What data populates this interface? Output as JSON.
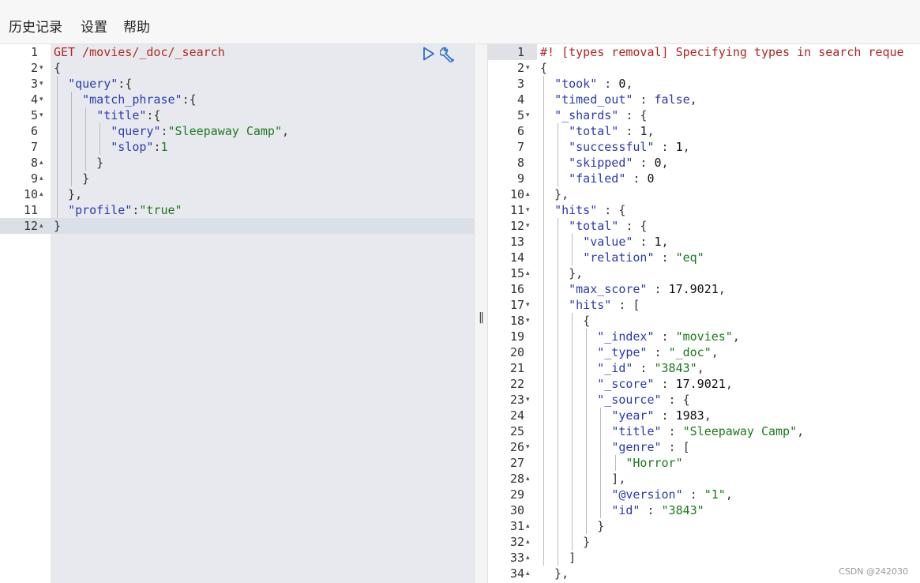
{
  "menu": {
    "history": "历史记录",
    "settings": "设置",
    "help": "帮助"
  },
  "request_editor": {
    "active_line": 12,
    "line_numbers": [
      "1",
      "2",
      "3",
      "4",
      "5",
      "6",
      "7",
      "8",
      "9",
      "10",
      "11",
      "12"
    ],
    "fold_markers": [
      "",
      "▾",
      "▾",
      "▾",
      "▾",
      "",
      "",
      "▴",
      "▴",
      "▴",
      "",
      "▴"
    ],
    "lines": [
      [
        [
          "m",
          "GET /movies/_doc/_search"
        ]
      ],
      [
        [
          "p",
          "{"
        ]
      ],
      [
        [
          "p",
          "  "
        ],
        [
          "k",
          "\"query\""
        ],
        [
          "p",
          ":{"
        ]
      ],
      [
        [
          "p",
          "    "
        ],
        [
          "k",
          "\"match_phrase\""
        ],
        [
          "p",
          ":{"
        ]
      ],
      [
        [
          "p",
          "      "
        ],
        [
          "k",
          "\"title\""
        ],
        [
          "p",
          ":{"
        ]
      ],
      [
        [
          "p",
          "        "
        ],
        [
          "k",
          "\"query\""
        ],
        [
          "p",
          ":"
        ],
        [
          "s",
          "\"Sleepaway Camp\""
        ],
        [
          "p",
          ","
        ]
      ],
      [
        [
          "p",
          "        "
        ],
        [
          "k",
          "\"slop\""
        ],
        [
          "p",
          ":"
        ],
        [
          "s",
          "1"
        ]
      ],
      [
        [
          "p",
          "      }"
        ]
      ],
      [
        [
          "p",
          "    }"
        ]
      ],
      [
        [
          "p",
          "  },"
        ]
      ],
      [
        [
          "p",
          "  "
        ],
        [
          "k",
          "\"profile\""
        ],
        [
          "p",
          ":"
        ],
        [
          "s",
          "\"true\""
        ]
      ],
      [
        [
          "p",
          "}"
        ]
      ]
    ]
  },
  "response_viewer": {
    "line_numbers": [
      "1",
      "2",
      "3",
      "4",
      "5",
      "6",
      "7",
      "8",
      "9",
      "10",
      "11",
      "12",
      "13",
      "14",
      "15",
      "16",
      "17",
      "18",
      "19",
      "20",
      "21",
      "22",
      "23",
      "24",
      "25",
      "26",
      "27",
      "28",
      "29",
      "30",
      "31",
      "32",
      "33",
      "34"
    ],
    "fold_markers": [
      "",
      "▾",
      "",
      "",
      "▾",
      "",
      "",
      "",
      "",
      "▴",
      "▾",
      "▾",
      "",
      "",
      "▴",
      "",
      "▾",
      "▾",
      "",
      "",
      "",
      "",
      "▾",
      "",
      "",
      "▾",
      "",
      "▴",
      "",
      "",
      "▴",
      "▴",
      "▴",
      "▴"
    ],
    "lines": [
      [
        [
          "c",
          "#! [types removal] Specifying types in search reque"
        ]
      ],
      [
        [
          "p",
          "{"
        ]
      ],
      [
        [
          "p",
          "  "
        ],
        [
          "k",
          "\"took\""
        ],
        [
          "p",
          " : "
        ],
        [
          "n",
          "0"
        ],
        [
          "p",
          ","
        ]
      ],
      [
        [
          "p",
          "  "
        ],
        [
          "k",
          "\"timed_out\""
        ],
        [
          "p",
          " : "
        ],
        [
          "kw",
          "false"
        ],
        [
          "p",
          ","
        ]
      ],
      [
        [
          "p",
          "  "
        ],
        [
          "k",
          "\"_shards\""
        ],
        [
          "p",
          " : {"
        ]
      ],
      [
        [
          "p",
          "    "
        ],
        [
          "k",
          "\"total\""
        ],
        [
          "p",
          " : "
        ],
        [
          "n",
          "1"
        ],
        [
          "p",
          ","
        ]
      ],
      [
        [
          "p",
          "    "
        ],
        [
          "k",
          "\"successful\""
        ],
        [
          "p",
          " : "
        ],
        [
          "n",
          "1"
        ],
        [
          "p",
          ","
        ]
      ],
      [
        [
          "p",
          "    "
        ],
        [
          "k",
          "\"skipped\""
        ],
        [
          "p",
          " : "
        ],
        [
          "n",
          "0"
        ],
        [
          "p",
          ","
        ]
      ],
      [
        [
          "p",
          "    "
        ],
        [
          "k",
          "\"failed\""
        ],
        [
          "p",
          " : "
        ],
        [
          "n",
          "0"
        ]
      ],
      [
        [
          "p",
          "  },"
        ]
      ],
      [
        [
          "p",
          "  "
        ],
        [
          "k",
          "\"hits\""
        ],
        [
          "p",
          " : {"
        ]
      ],
      [
        [
          "p",
          "    "
        ],
        [
          "k",
          "\"total\""
        ],
        [
          "p",
          " : {"
        ]
      ],
      [
        [
          "p",
          "      "
        ],
        [
          "k",
          "\"value\""
        ],
        [
          "p",
          " : "
        ],
        [
          "n",
          "1"
        ],
        [
          "p",
          ","
        ]
      ],
      [
        [
          "p",
          "      "
        ],
        [
          "k",
          "\"relation\""
        ],
        [
          "p",
          " : "
        ],
        [
          "s",
          "\"eq\""
        ]
      ],
      [
        [
          "p",
          "    },"
        ]
      ],
      [
        [
          "p",
          "    "
        ],
        [
          "k",
          "\"max_score\""
        ],
        [
          "p",
          " : "
        ],
        [
          "n",
          "17.9021"
        ],
        [
          "p",
          ","
        ]
      ],
      [
        [
          "p",
          "    "
        ],
        [
          "k",
          "\"hits\""
        ],
        [
          "p",
          " : ["
        ]
      ],
      [
        [
          "p",
          "      {"
        ]
      ],
      [
        [
          "p",
          "        "
        ],
        [
          "k",
          "\"_index\""
        ],
        [
          "p",
          " : "
        ],
        [
          "s",
          "\"movies\""
        ],
        [
          "p",
          ","
        ]
      ],
      [
        [
          "p",
          "        "
        ],
        [
          "k",
          "\"_type\""
        ],
        [
          "p",
          " : "
        ],
        [
          "s",
          "\"_doc\""
        ],
        [
          "p",
          ","
        ]
      ],
      [
        [
          "p",
          "        "
        ],
        [
          "k",
          "\"_id\""
        ],
        [
          "p",
          " : "
        ],
        [
          "s",
          "\"3843\""
        ],
        [
          "p",
          ","
        ]
      ],
      [
        [
          "p",
          "        "
        ],
        [
          "k",
          "\"_score\""
        ],
        [
          "p",
          " : "
        ],
        [
          "n",
          "17.9021"
        ],
        [
          "p",
          ","
        ]
      ],
      [
        [
          "p",
          "        "
        ],
        [
          "k",
          "\"_source\""
        ],
        [
          "p",
          " : {"
        ]
      ],
      [
        [
          "p",
          "          "
        ],
        [
          "k",
          "\"year\""
        ],
        [
          "p",
          " : "
        ],
        [
          "n",
          "1983"
        ],
        [
          "p",
          ","
        ]
      ],
      [
        [
          "p",
          "          "
        ],
        [
          "k",
          "\"title\""
        ],
        [
          "p",
          " : "
        ],
        [
          "s",
          "\"Sleepaway Camp\""
        ],
        [
          "p",
          ","
        ]
      ],
      [
        [
          "p",
          "          "
        ],
        [
          "k",
          "\"genre\""
        ],
        [
          "p",
          " : ["
        ]
      ],
      [
        [
          "p",
          "            "
        ],
        [
          "s",
          "\"Horror\""
        ]
      ],
      [
        [
          "p",
          "          ],"
        ]
      ],
      [
        [
          "p",
          "          "
        ],
        [
          "k",
          "\"@version\""
        ],
        [
          "p",
          " : "
        ],
        [
          "s",
          "\"1\""
        ],
        [
          "p",
          ","
        ]
      ],
      [
        [
          "p",
          "          "
        ],
        [
          "k",
          "\"id\""
        ],
        [
          "p",
          " : "
        ],
        [
          "s",
          "\"3843\""
        ]
      ],
      [
        [
          "p",
          "        }"
        ]
      ],
      [
        [
          "p",
          "      }"
        ]
      ],
      [
        [
          "p",
          "    ]"
        ]
      ],
      [
        [
          "p",
          "  },"
        ]
      ]
    ]
  },
  "splitter": {
    "grip": "‖"
  },
  "watermark": "CSDN @242030"
}
